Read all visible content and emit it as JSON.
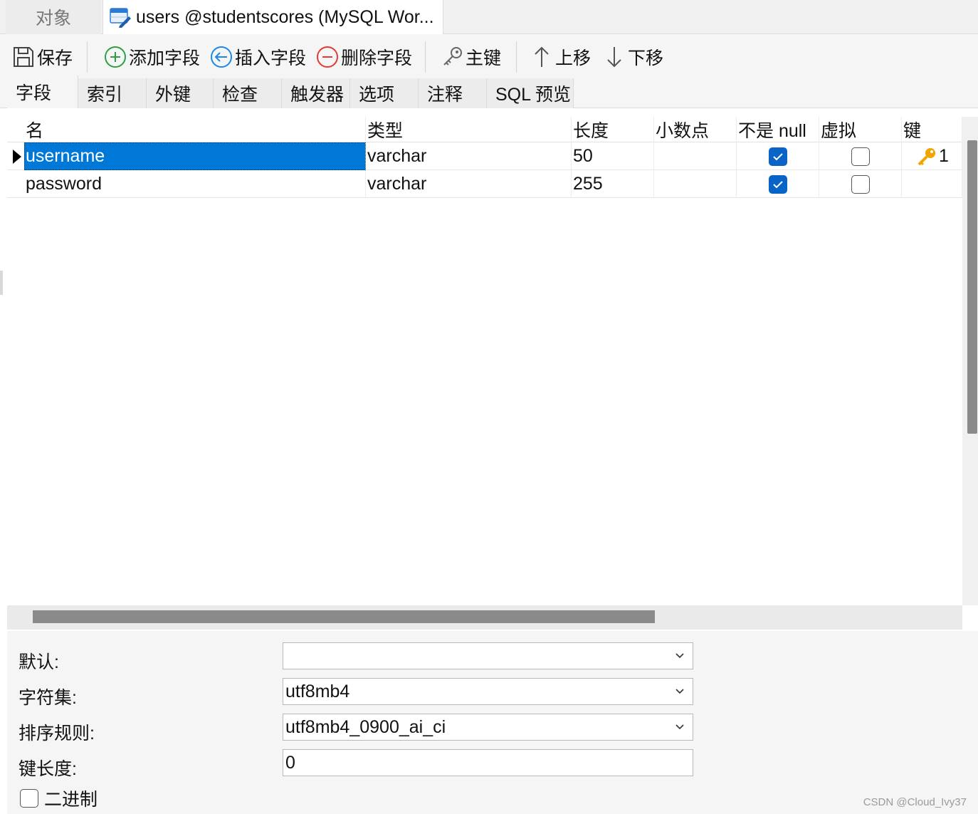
{
  "doc_tabs": {
    "objects_label": "对象",
    "active_label": "users @studentscores (MySQL Wor..."
  },
  "toolbar": {
    "save": "保存",
    "add_field": "添加字段",
    "insert_field": "插入字段",
    "delete_field": "删除字段",
    "primary_key": "主键",
    "move_up": "上移",
    "move_down": "下移"
  },
  "sub_tabs": [
    "字段",
    "索引",
    "外键",
    "检查",
    "触发器",
    "选项",
    "注释",
    "SQL 预览"
  ],
  "grid": {
    "columns": [
      "名",
      "类型",
      "长度",
      "小数点",
      "不是 null",
      "虚拟",
      "键"
    ],
    "rows": [
      {
        "name": "username",
        "type": "varchar",
        "length": "50",
        "decimals": "",
        "not_null": true,
        "virtual": false,
        "key": "1",
        "selected": true
      },
      {
        "name": "password",
        "type": "varchar",
        "length": "255",
        "decimals": "",
        "not_null": true,
        "virtual": false,
        "key": "",
        "selected": false
      }
    ]
  },
  "props": {
    "default_label": "默认:",
    "default_value": "",
    "charset_label": "字符集:",
    "charset_value": "utf8mb4",
    "collation_label": "排序规则:",
    "collation_value": "utf8mb4_0900_ai_ci",
    "key_length_label": "键长度:",
    "key_length_value": "0",
    "binary_label": "二进制",
    "binary_checked": false
  },
  "watermark": "CSDN @Cloud_Ivy37",
  "colors": {
    "selection": "#0078d7",
    "checkbox_on": "#0a64c8",
    "key_icon": "#f0a500",
    "add_icon": "#2ea043",
    "insert_icon": "#1e88e5",
    "delete_icon": "#e53935"
  }
}
